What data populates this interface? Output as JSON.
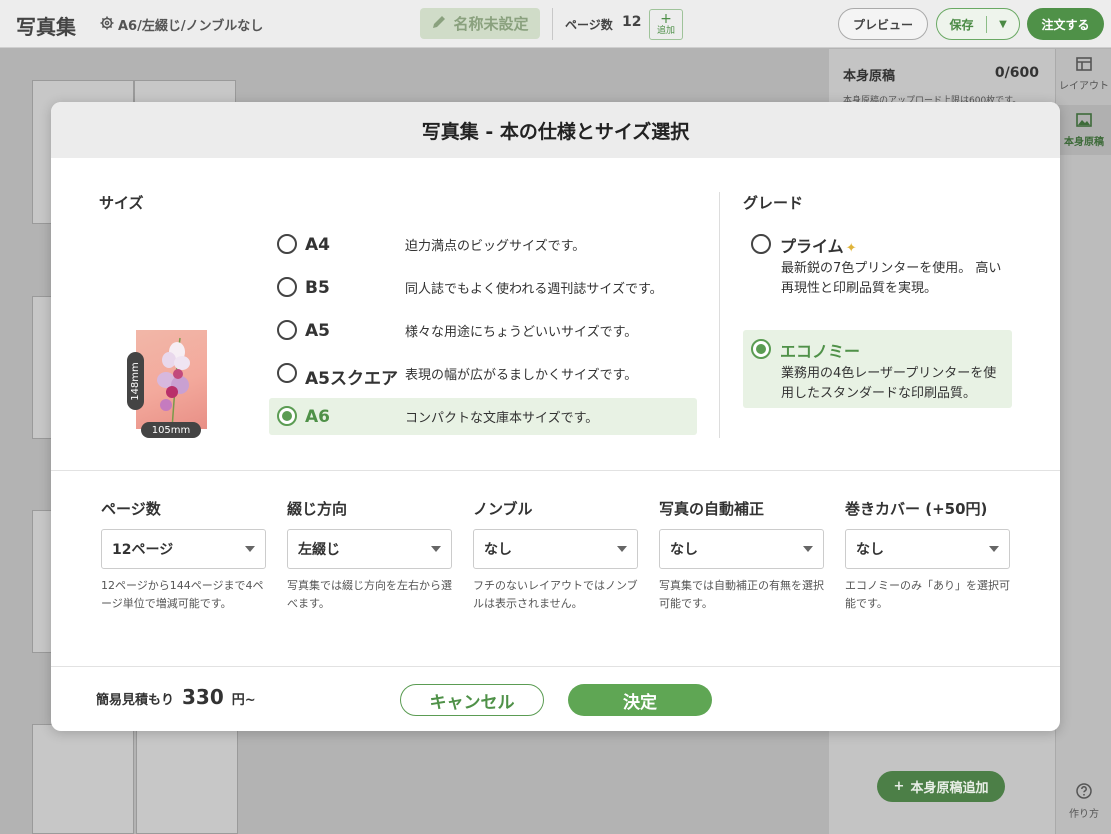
{
  "topbar": {
    "app_title": "写真集",
    "spec_summary": "A6/左綴じ/ノンブルなし",
    "book_name": "名称未設定",
    "page_count_label": "ページ数",
    "page_count": "12",
    "add_label": "追加",
    "preview_label": "プレビュー",
    "save_label": "保存",
    "order_label": "注文する"
  },
  "right_panel": {
    "title": "本身原稿",
    "count": "0/600",
    "note": "本身原稿のアップロード上限は600枚です。",
    "add_button": "本身原稿追加"
  },
  "side_rail": {
    "items": [
      {
        "label": "レイアウト",
        "icon": "layout-icon"
      },
      {
        "label": "本身原稿",
        "icon": "image-icon"
      }
    ],
    "help_label": "作り方"
  },
  "modal": {
    "title": "写真集 - 本の仕様とサイズ選択",
    "size_section": "サイズ",
    "dimension_height": "148mm",
    "dimension_width": "105mm",
    "sizes": [
      {
        "name": "A4",
        "desc": "迫力満点のビッグサイズです。",
        "selected": false
      },
      {
        "name": "B5",
        "desc": "同人誌でもよく使われる週刊誌サイズです。",
        "selected": false
      },
      {
        "name": "A5",
        "desc": "様々な用途にちょうどいいサイズです。",
        "selected": false
      },
      {
        "name": "A5スクエア",
        "desc": "表現の幅が広がるましかくサイズです。",
        "selected": false
      },
      {
        "name": "A6",
        "desc": "コンパクトな文庫本サイズです。",
        "selected": true
      }
    ],
    "grade_section": "グレード",
    "grades": [
      {
        "name": "プライム",
        "desc": "最新鋭の7色プリンターを使用。 高い再現性と印刷品質を実現。",
        "selected": false
      },
      {
        "name": "エコノミー",
        "desc": "業務用の4色レーザープリンターを使用したスタンダードな印刷品質。",
        "selected": true
      }
    ],
    "options": [
      {
        "label": "ページ数",
        "value": "12ページ",
        "help": "12ページから144ページまで4ページ単位で増減可能です。"
      },
      {
        "label": "綴じ方向",
        "value": "左綴じ",
        "help": "写真集では綴じ方向を左右から選べます。"
      },
      {
        "label": "ノンブル",
        "value": "なし",
        "help": "フチのないレイアウトではノンブルは表示されません。"
      },
      {
        "label": "写真の自動補正",
        "value": "なし",
        "help": "写真集では自動補正の有無を選択可能です。"
      },
      {
        "label": "巻きカバー (+50円)",
        "value": "なし",
        "help": "エコノミーのみ「あり」を選択可能です。"
      }
    ],
    "estimate_label": "簡易見積もり",
    "estimate_value": "330",
    "estimate_unit": "円~",
    "cancel_label": "キャンセル",
    "confirm_label": "決定"
  },
  "colors": {
    "accent": "#5b9c53",
    "selected_bg": "#e8f2e4",
    "overlay": "#b3b3b3"
  }
}
